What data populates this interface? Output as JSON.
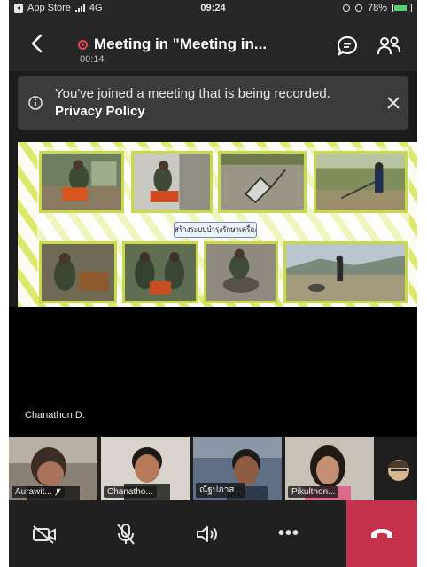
{
  "status_bar": {
    "carrier": "App Store",
    "network": "4G",
    "time": "09:24",
    "battery": "78%",
    "battery_level": 0.78
  },
  "meeting": {
    "title": "Meeting in \"Meeting in...",
    "timer": "00:14"
  },
  "banner": {
    "text": "You've joined a meeting that is being recorded.",
    "link": "Privacy Policy"
  },
  "shared_content": {
    "caption": "สร้างระบบบำรุงรักษาเครื่อง"
  },
  "stage": {
    "speaker_name": "Chanathon D."
  },
  "participants": [
    {
      "name": "Aurawit...",
      "muted": true
    },
    {
      "name": "Chanatho...",
      "muted": false
    },
    {
      "name": "ณัฐปภาส...",
      "muted": false
    },
    {
      "name": "Pikulthon...",
      "muted": false
    }
  ],
  "controls": {
    "camera": "camera-off-icon",
    "mic": "mic-off-icon",
    "speaker": "speaker-icon",
    "more": "•••",
    "hangup": "hangup-icon",
    "hangup_color": "#c4314b"
  }
}
